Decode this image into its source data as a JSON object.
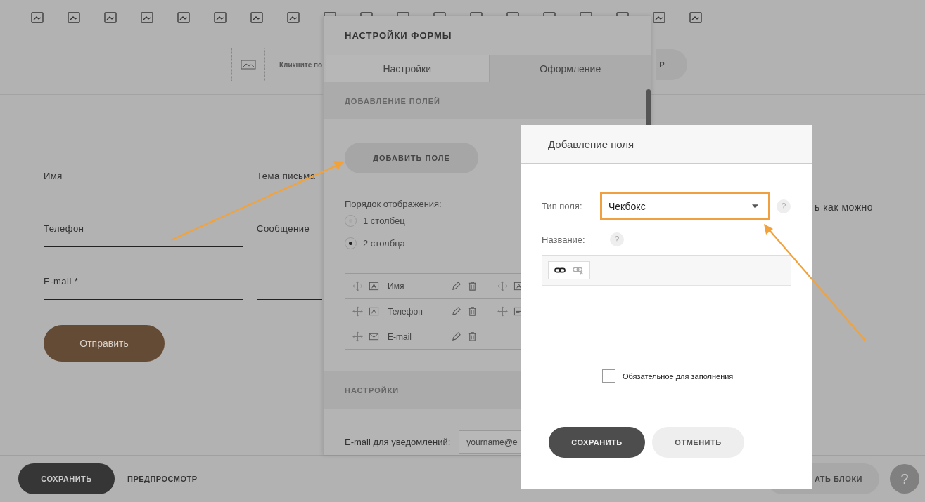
{
  "cover": {
    "caption": "Кликните по",
    "button_label": "Р"
  },
  "form": {
    "left_fields": [
      {
        "label": "Имя"
      },
      {
        "label": "Телефон"
      },
      {
        "label": "E-mail *"
      }
    ],
    "right_fields": [
      {
        "label": "Тема письма",
        "kind": "line"
      },
      {
        "label": "Сообщение",
        "kind": "area"
      }
    ],
    "submit": "Отправить",
    "side_text": "ь как можно"
  },
  "bottom_bar": {
    "save": "СОХРАНИТЬ",
    "preview": "ПРЕДПРОСМОТР",
    "blocks_button": "АТЬ БЛОКИ",
    "help": "?"
  },
  "settings_panel": {
    "title": "НАСТРОЙКИ ФОРМЫ",
    "tabs": [
      {
        "label": "Настройки",
        "selected": true
      },
      {
        "label": "Оформление",
        "selected": false
      }
    ],
    "section_add": "ДОБАВЛЕНИЕ ПОЛЕЙ",
    "add_button": "ДОБАВИТЬ ПОЛЕ",
    "order_label": "Порядок отображения:",
    "order_options": [
      {
        "label": "1 столбец",
        "selected": false
      },
      {
        "label": "2 столбца",
        "selected": true
      }
    ],
    "field_rows": [
      {
        "cells": [
          {
            "kind": "text",
            "label": "Имя"
          },
          {
            "kind": "text"
          }
        ]
      },
      {
        "cells": [
          {
            "kind": "text",
            "label": "Телефон"
          },
          {
            "kind": "textarea"
          }
        ]
      },
      {
        "cells": [
          {
            "kind": "email",
            "label": "E-mail"
          }
        ]
      }
    ],
    "section_settings": "НАСТРОЙКИ",
    "notify_label": "E-mail для уведомлений:",
    "notify_placeholder": "yourname@e"
  },
  "modal": {
    "title": "Добавление поля",
    "type_label": "Тип поля:",
    "type_value": "Чекбокс",
    "type_help": "?",
    "name_label": "Название:",
    "name_help": "?",
    "required": {
      "label": "Обязательное для заполнения",
      "checked": false
    },
    "save": "СОХРАНИТЬ",
    "cancel": "ОТМЕНИТЬ"
  }
}
